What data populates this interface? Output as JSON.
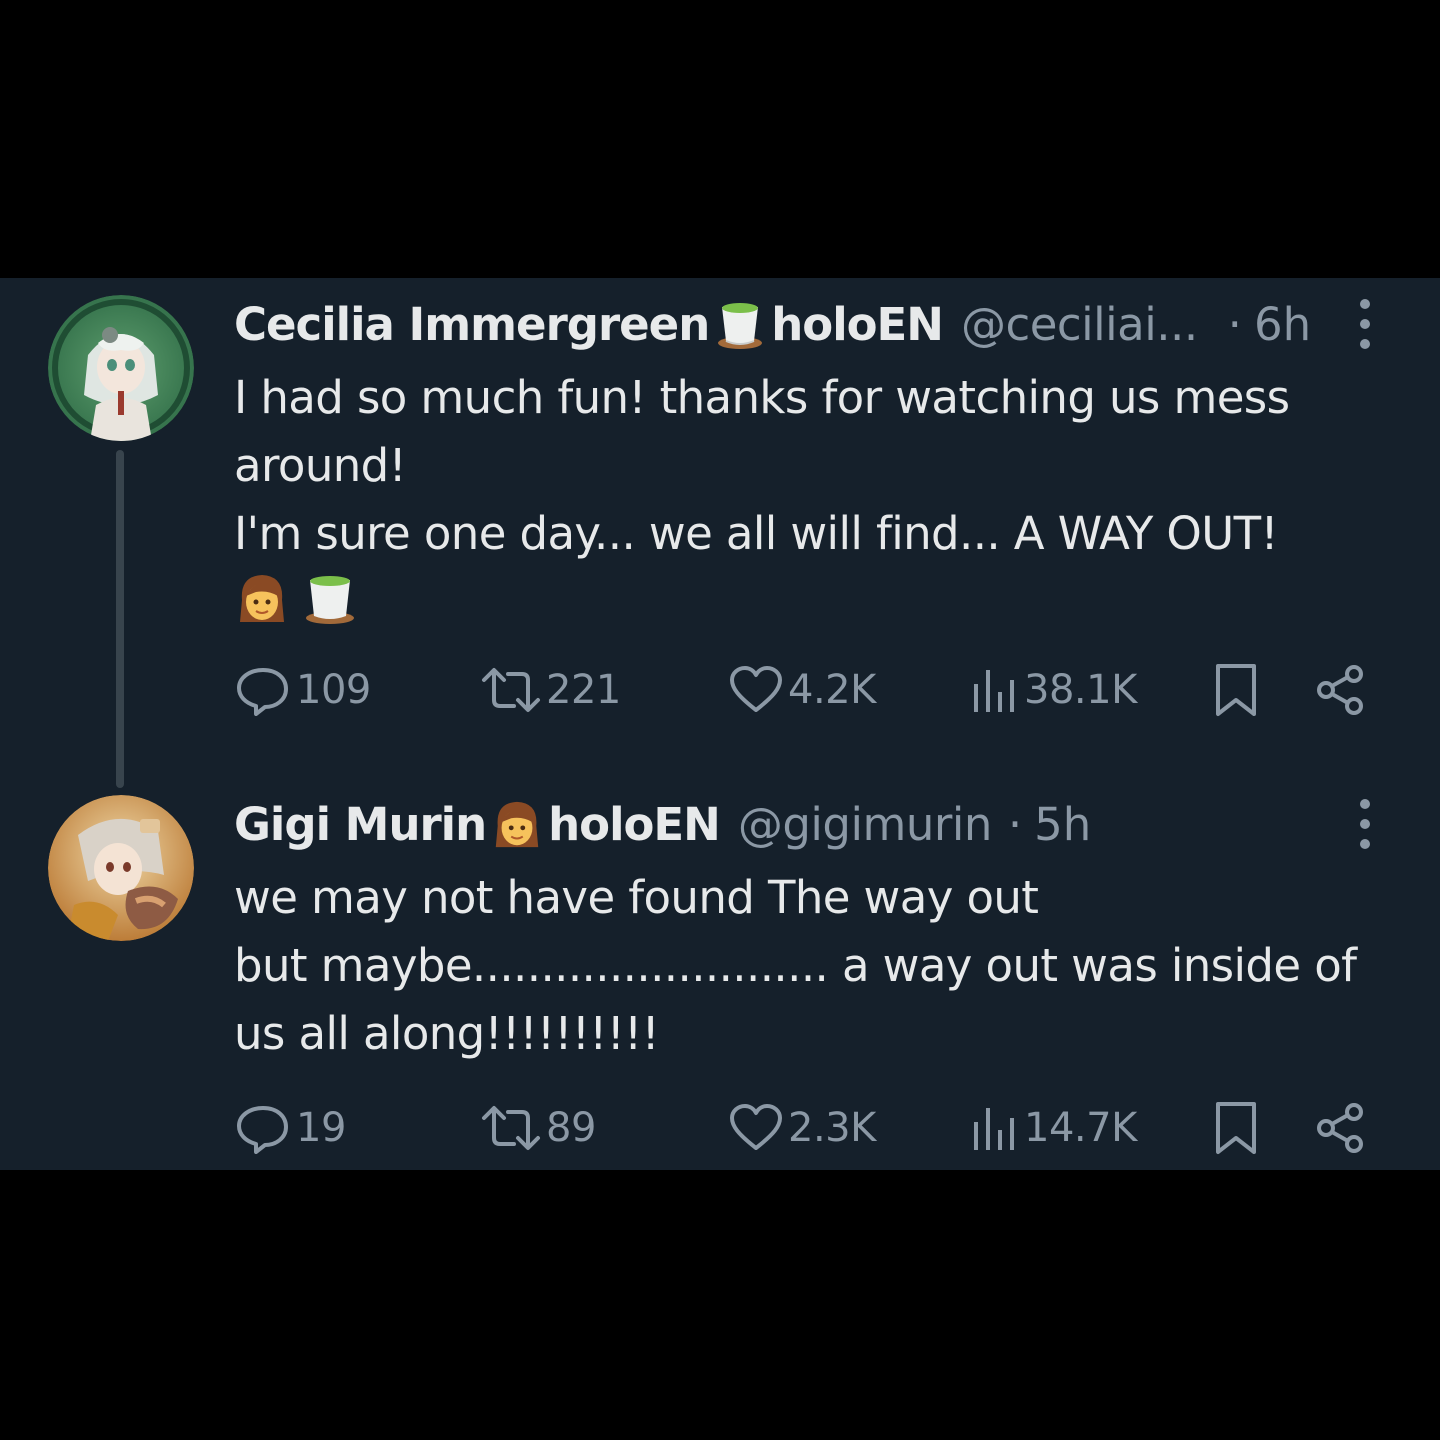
{
  "tweets": [
    {
      "display_name": "Cecilia Immergreen",
      "name_suffix": "holoEN",
      "handle": "@ceciliai...",
      "separator": "·",
      "time": "6h",
      "text_lines": [
        "I had so much fun! thanks for watching us mess",
        "around!",
        "I'm sure one day... we all will find... A WAY OUT!"
      ],
      "emoji_line": [
        "girl-emoji",
        "tea-cup-emoji"
      ],
      "badge_emoji": "tea-cup-emoji",
      "replies": "109",
      "retweets": "221",
      "likes": "4.2K",
      "views": "38.1K"
    },
    {
      "display_name": "Gigi Murin",
      "name_suffix": "holoEN",
      "handle": "@gigimurin",
      "separator": "·",
      "time": "5h",
      "text_lines": [
        "we may not have found The way out",
        "but maybe.......................... a way out was inside of",
        "us all along!!!!!!!!!!"
      ],
      "badge_emoji": "girl-emoji",
      "replies": "19",
      "retweets": "89",
      "likes": "2.3K",
      "views": "14.7K"
    }
  ],
  "colors": {
    "background": "#15202b",
    "text": "#e7e9ea",
    "muted": "#8b98a5",
    "thread_line": "#38444d"
  },
  "icons": [
    "reply-icon",
    "retweet-icon",
    "like-icon",
    "views-icon",
    "bookmark-icon",
    "share-icon",
    "more-icon"
  ]
}
